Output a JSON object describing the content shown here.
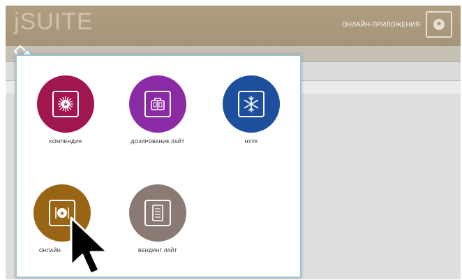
{
  "app": {
    "brand": "jSUITE",
    "online_apps_label": "ОНЛАЙН-ПРИЛОЖЕНИЯ",
    "online_apps_icon": "online-plate-icon"
  },
  "colors": {
    "topbar": "#a89679",
    "popup_border": "#9ec3d3"
  },
  "apps": [
    {
      "label": "КОМПЕНДИЯ",
      "color": "#a0164f",
      "icon": "compendium-icon"
    },
    {
      "label": "ДОЗИРОВАНИЕ ЛАЙТ",
      "color": "#8b2aa5",
      "icon": "dosage-icon"
    },
    {
      "label": "НУУК",
      "color": "#1d4f9c",
      "icon": "snowflake-icon"
    },
    {
      "label": "ОНЛАЙН",
      "color": "#9a6415",
      "icon": "plate-icon"
    },
    {
      "label": "ВЕНДИНГ ЛАЙТ",
      "color": "#8a7a73",
      "icon": "vending-icon"
    }
  ]
}
